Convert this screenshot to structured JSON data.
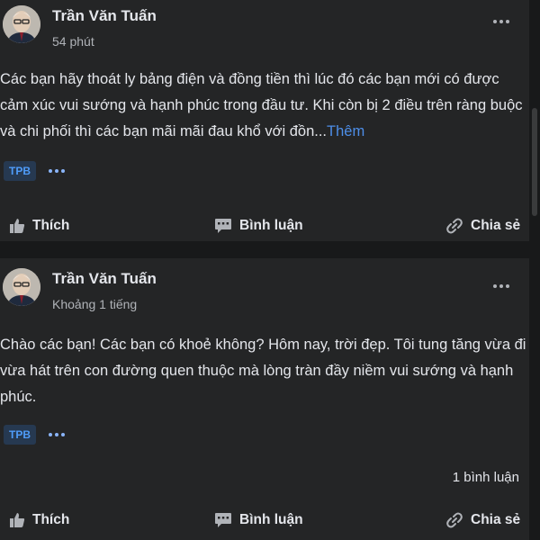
{
  "posts": [
    {
      "author": "Trần Văn Tuấn",
      "time": "54 phút",
      "text": "Các bạn hãy thoát ly bảng điện và đồng tiền thì lúc đó các bạn mới có được cảm xúc vui sướng và hạnh phúc trong đầu tư. Khi còn bị 2 điều trên ràng buộc và chi phối thì các bạn mãi mãi đau khổ với đồn...",
      "see_more": "Thêm",
      "tag": "TPB",
      "comment_count": "",
      "actions": {
        "like": "Thích",
        "comment": "Bình luận",
        "share": "Chia sẻ"
      }
    },
    {
      "author": "Trần Văn Tuấn",
      "time": "Khoảng 1 tiếng",
      "text": "Chào các bạn! Các bạn có khoẻ không? Hôm nay, trời đẹp. Tôi tung tăng vừa đi vừa hát trên con đường quen thuộc mà lòng tràn đầy niềm vui sướng và hạnh phúc.",
      "tag": "TPB",
      "comment_count": "1 bình luận",
      "actions": {
        "like": "Thích",
        "comment": "Bình luận",
        "share": "Chia sẻ"
      }
    }
  ],
  "icons": {
    "avatar": "avatar-portrait",
    "more": "more-dots-icon",
    "like": "thumbs-up-icon",
    "comment": "comment-bubble-icon",
    "share": "share-link-icon"
  },
  "colors": {
    "background": "#18191a",
    "card": "#242526",
    "text": "#e4e6eb",
    "secondary": "#b0b3b8",
    "link": "#4d8ee8",
    "tag_bg": "#263951",
    "tag_text": "#4f9cf9"
  }
}
